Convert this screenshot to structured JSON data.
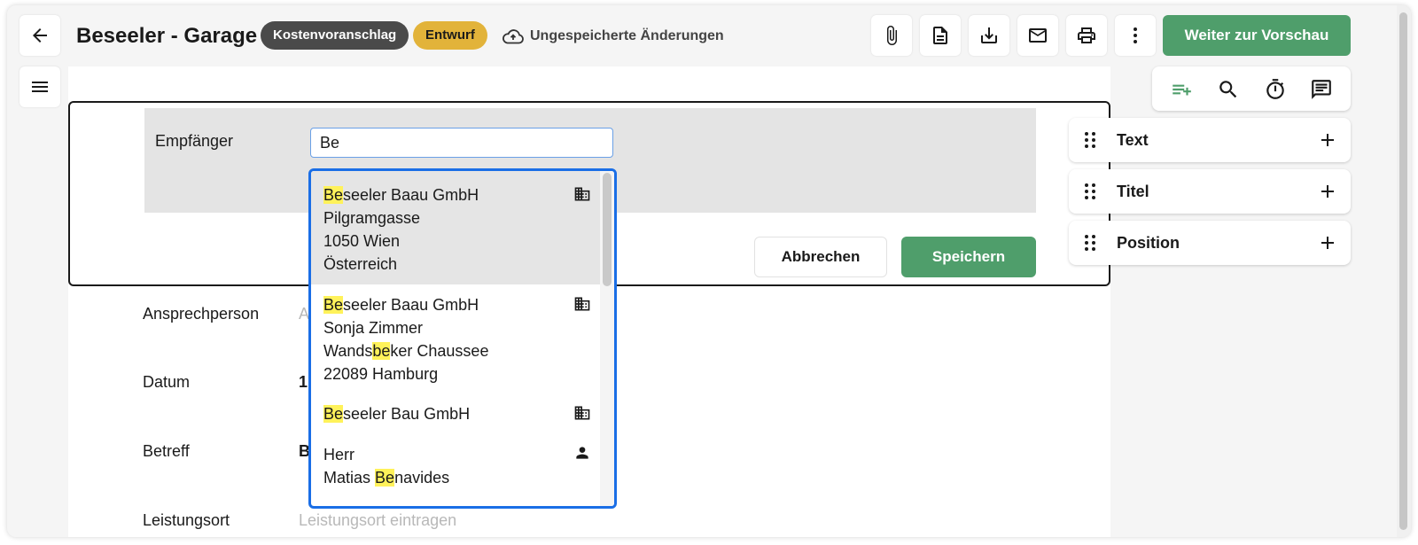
{
  "header": {
    "title": "Beseeler - Garage",
    "badge_type": "Kostenvoranschlag",
    "badge_status": "Entwurf",
    "unsaved_text": "Ungespeicherte Änderungen",
    "preview_button": "Weiter zur Vorschau",
    "icons": [
      "back-arrow-icon",
      "attachment-icon",
      "document-icon",
      "download-icon",
      "mail-icon",
      "print-icon",
      "more-vertical-icon"
    ]
  },
  "editor": {
    "recipient_label": "Empfänger",
    "recipient_value": "Be",
    "cancel_label": "Abbrechen",
    "save_label": "Speichern"
  },
  "fields": {
    "contact_label": "Ansprechperson",
    "contact_placeholder": "A",
    "date_label": "Datum",
    "date_value": "1",
    "subject_label": "Betreff",
    "subject_value": "B",
    "location_label": "Leistungsort",
    "location_placeholder": "Leistungsort eintragen"
  },
  "dropdown": {
    "query": "Be",
    "items": [
      {
        "icon": "company-icon",
        "lines": [
          "Beseeler Baau GmbH",
          "Pilgramgasse",
          "1050 Wien",
          "Österreich"
        ]
      },
      {
        "icon": "company-icon",
        "lines": [
          "Beseeler Baau GmbH",
          "Sonja Zimmer",
          "Wandsbeker Chaussee",
          "22089 Hamburg"
        ]
      },
      {
        "icon": "company-icon",
        "lines": [
          "Beseeler Bau GmbH"
        ]
      },
      {
        "icon": "person-icon",
        "lines": [
          "Herr",
          "Matias Benavides"
        ]
      }
    ]
  },
  "sidebar": {
    "tools": [
      "add-block-icon",
      "search-icon",
      "timer-icon",
      "comment-icon"
    ],
    "blocks": [
      {
        "label": "Text"
      },
      {
        "label": "Titel"
      },
      {
        "label": "Position"
      }
    ]
  },
  "colors": {
    "primary": "#4f9e6b",
    "badge_dark": "#4a4a4a",
    "badge_yellow": "#e2b33a",
    "highlight": "#fff25a",
    "focus": "#1a6ee6"
  }
}
